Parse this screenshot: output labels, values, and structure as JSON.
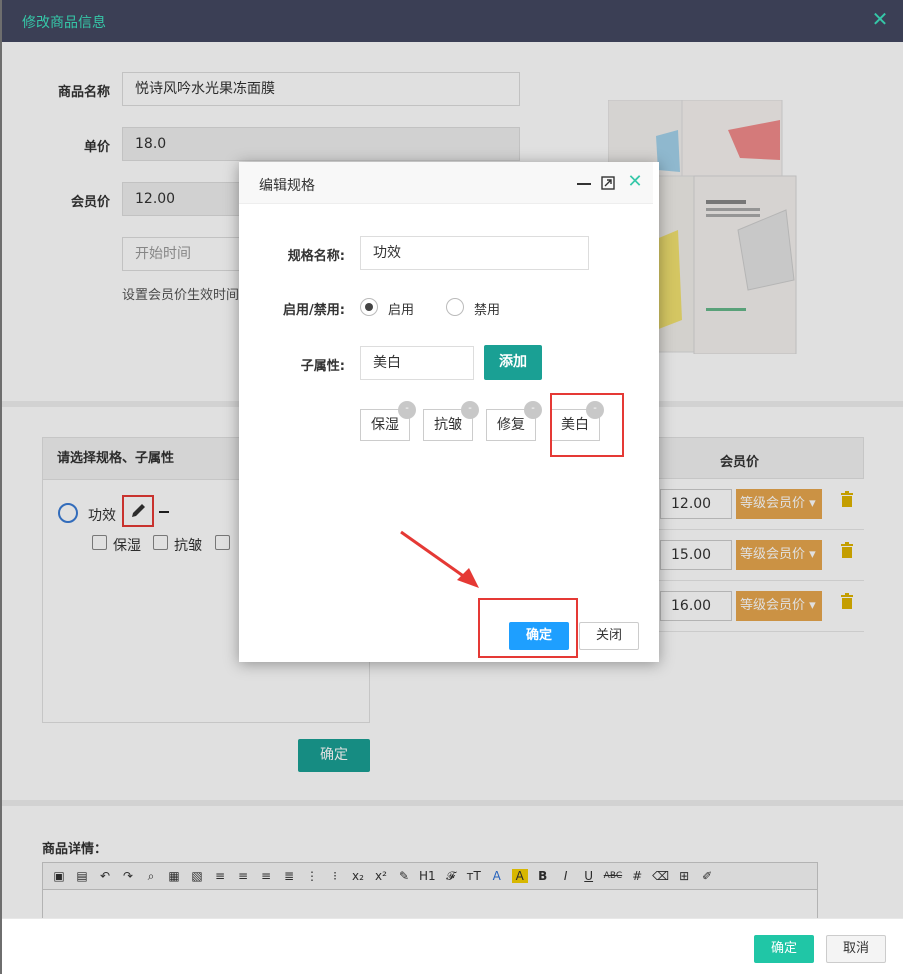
{
  "window": {
    "title": "修改商品信息"
  },
  "form": {
    "name_label": "商品名称",
    "name_value": "悦诗风吟水光果冻面膜",
    "price_label": "单价",
    "price_value": "18.0",
    "member_price_label": "会员价",
    "member_price_value": "12.00",
    "start_time_placeholder": "开始时间",
    "member_hint": "设置会员价生效时间"
  },
  "spec_panel": {
    "header": "请选择规格、子属性",
    "spec_name": "功效",
    "children": [
      "保湿",
      "抗皱",
      "修复"
    ],
    "confirm_label": "确定"
  },
  "price_table": {
    "header": "会员价",
    "level_label": "等级会员价",
    "rows": [
      {
        "price": "12.00"
      },
      {
        "price": "15.00"
      },
      {
        "price": "16.00"
      }
    ]
  },
  "editor": {
    "label": "商品详情：",
    "tools": [
      "H1",
      "A",
      "A",
      "B",
      "I",
      "U",
      "ABC"
    ]
  },
  "footer": {
    "ok_label": "确定",
    "cancel_label": "取消"
  },
  "dialog": {
    "title": "编辑规格",
    "spec_name_label": "规格名称:",
    "spec_name_value": "功效",
    "status_label": "启用/禁用:",
    "enable_label": "启用",
    "disable_label": "禁用",
    "child_label": "子属性:",
    "child_input_value": "美白",
    "add_label": "添加",
    "tags": [
      "保湿",
      "抗皱",
      "修复",
      "美白"
    ],
    "tag_remove": "-",
    "ok_label": "确定",
    "close_label": "关闭"
  },
  "colors": {
    "header_bg": "#3b3f55",
    "accent_teal": "#35c7a8",
    "primary_green": "#1aa094",
    "level_orange": "#e8a74e",
    "confirm_blue": "#1e9fff",
    "highlight_red": "#e53935"
  }
}
